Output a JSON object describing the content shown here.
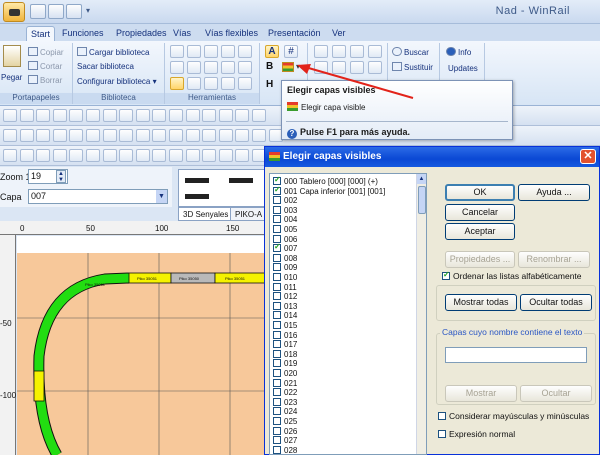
{
  "window": {
    "title": "Nad - WinRail"
  },
  "tabs": [
    "Start",
    "Funciones",
    "Propiedades",
    "Vías",
    "Vías flexibles",
    "Presentación",
    "Ver"
  ],
  "ribbon": {
    "portapapeles": {
      "label": "Portapapeles",
      "paste": "Pegar",
      "copy": "Copiar",
      "cut": "Cortar",
      "delete": "Borrar"
    },
    "biblioteca": {
      "label": "Biblioteca",
      "load": "Cargar biblioteca",
      "remove": "Sacar biblioteca",
      "configure": "Configurar biblioteca"
    },
    "herramientas": {
      "label": "Herramientas"
    },
    "search": {
      "find": "Buscar",
      "replace": "Sustituir"
    },
    "info": {
      "info": "Info",
      "updates": "Updates"
    },
    "letters": [
      "A",
      "B",
      "H"
    ]
  },
  "tooltip": {
    "title": "Elegir capas visibles",
    "line": "Elegir capa visible",
    "help": "Pulse F1 para más ayuda."
  },
  "left_panel": {
    "zoom_label": "Zoom 1:",
    "zoom_value": "19",
    "capa_label": "Capa",
    "capa_value": "007",
    "panel_tabs": [
      "3D Senyales",
      "PIKO-A"
    ]
  },
  "canvas": {
    "ruler_x": [
      "0",
      "50",
      "100",
      "150"
    ],
    "ruler_y": [
      "50",
      "100"
    ],
    "track_labels": [
      "Piko 35051",
      "Piko 35050",
      "Piko 35051",
      "Piko 35051"
    ]
  },
  "dialog": {
    "title": "Elegir capas visibles",
    "layers": [
      {
        "label": "000 Tablero [000] [000] (+)",
        "checked": true
      },
      {
        "label": "001 Capa inferior [001] [001]",
        "checked": true
      },
      {
        "label": "002",
        "checked": false
      },
      {
        "label": "003",
        "checked": false
      },
      {
        "label": "004",
        "checked": false
      },
      {
        "label": "005",
        "checked": false
      },
      {
        "label": "006",
        "checked": false
      },
      {
        "label": "007",
        "checked": true
      },
      {
        "label": "008",
        "checked": false
      },
      {
        "label": "009",
        "checked": false
      },
      {
        "label": "010",
        "checked": false
      },
      {
        "label": "011",
        "checked": false
      },
      {
        "label": "012",
        "checked": false
      },
      {
        "label": "013",
        "checked": false
      },
      {
        "label": "014",
        "checked": false
      },
      {
        "label": "015",
        "checked": false
      },
      {
        "label": "016",
        "checked": false
      },
      {
        "label": "017",
        "checked": false
      },
      {
        "label": "018",
        "checked": false
      },
      {
        "label": "019",
        "checked": false
      },
      {
        "label": "020",
        "checked": false
      },
      {
        "label": "021",
        "checked": false
      },
      {
        "label": "022",
        "checked": false
      },
      {
        "label": "023",
        "checked": false
      },
      {
        "label": "024",
        "checked": false
      },
      {
        "label": "025",
        "checked": false
      },
      {
        "label": "026",
        "checked": false
      },
      {
        "label": "027",
        "checked": false
      },
      {
        "label": "028",
        "checked": false
      }
    ],
    "ok": "OK",
    "help": "Ayuda ...",
    "cancel": "Cancelar",
    "accept": "Aceptar",
    "properties": "Propiedades ...",
    "rename": "Renombrar ...",
    "sort_label": "Ordenar las listas alfabéticamente",
    "show_all": "Mostrar todas",
    "hide_all": "Ocultar todas",
    "filter_legend": "Capas cuyo nombre contiene el texto",
    "filter_value": "",
    "show": "Mostrar",
    "hide": "Ocultar",
    "match_case": "Considerar mayúsculas y minúsculas",
    "regex": "Expresión normal"
  },
  "colors": {
    "accent": "#0a48d4",
    "board": "#f7c89a",
    "track_green": "#22dd11",
    "track_yellow": "#f5f200",
    "arrow": "#e2231a"
  }
}
